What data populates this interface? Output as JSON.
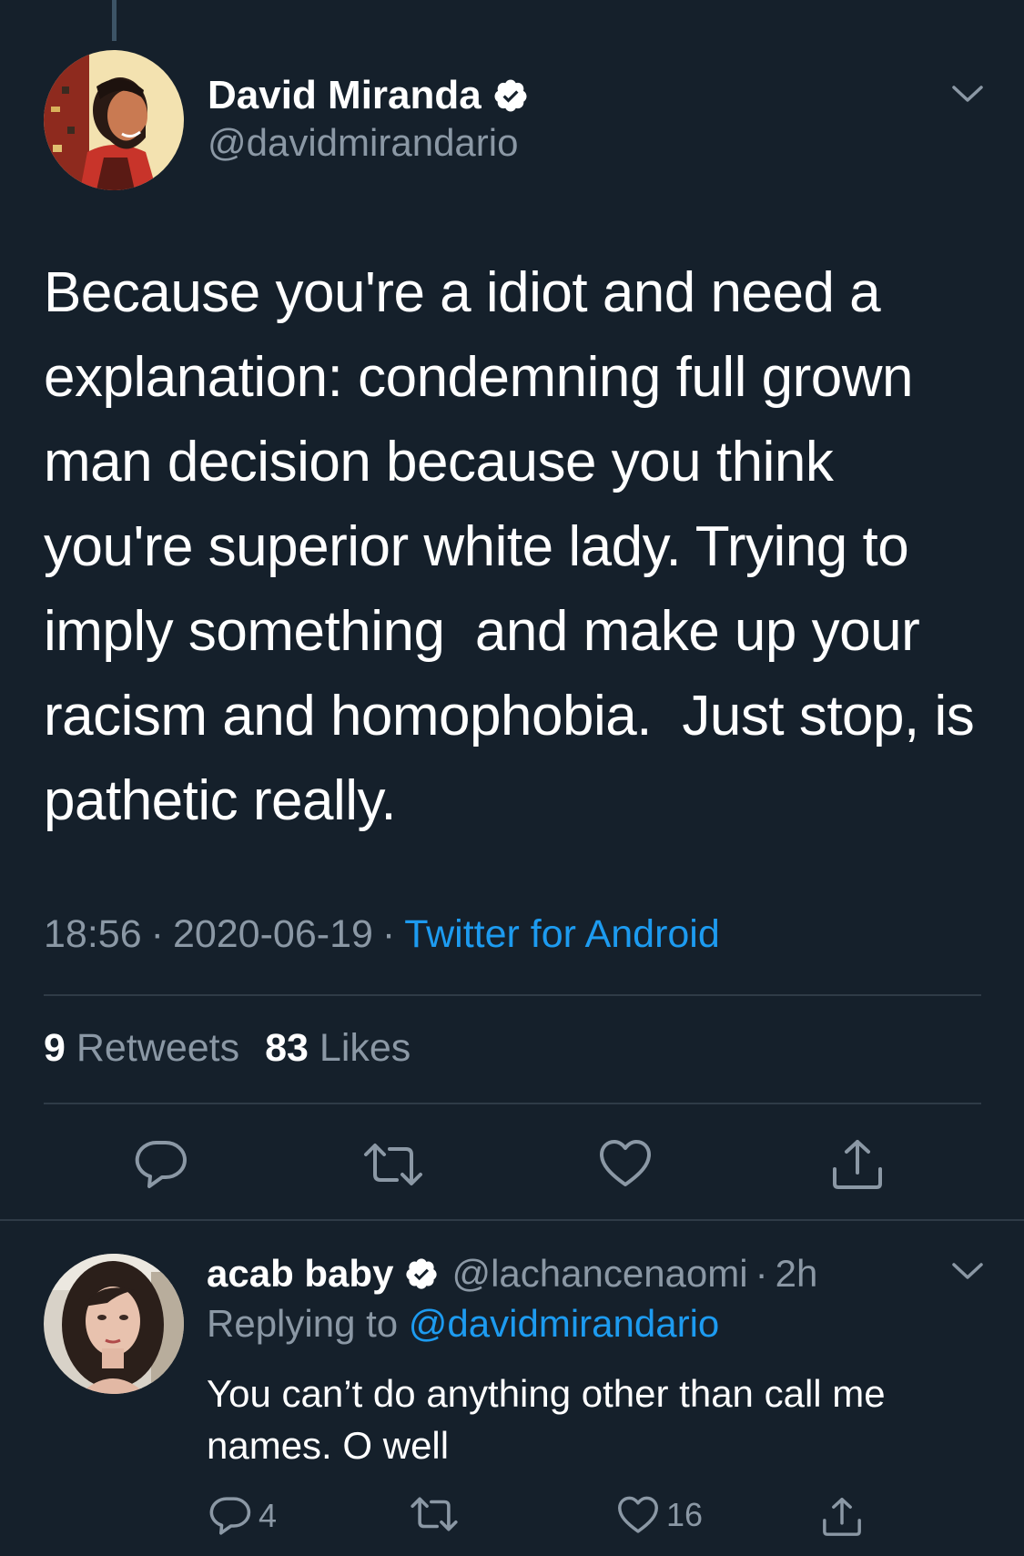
{
  "main_tweet": {
    "author_name": "David Miranda",
    "author_handle": "@davidmirandario",
    "text": "Because you're a idiot and need a explanation: condemning full grown man decision because you think you're superior white lady. Trying to imply something  and make up your racism and homophobia.  Just stop, is pathetic really.",
    "time": "18:56",
    "date": "2020-06-19",
    "separator": "·",
    "source": "Twitter for Android",
    "retweets_count": "9",
    "retweets_label": "Retweets",
    "likes_count": "83",
    "likes_label": "Likes",
    "icons": {
      "verified": "verified-badge-icon",
      "menu": "chevron-down-icon",
      "reply": "reply-icon",
      "retweet": "retweet-icon",
      "like": "heart-icon",
      "share": "share-icon"
    }
  },
  "reply_tweet": {
    "author_name": "acab baby",
    "author_handle": "@lachancenaomi",
    "dot": "·",
    "time": "2h",
    "replying_to_label": "Replying to",
    "replying_to_handle": "@davidmirandario",
    "text": "You can’t do anything other than call me names. O well",
    "reply_count": "4",
    "like_count": "16"
  },
  "colors": {
    "background": "#15202b",
    "text_primary": "#ffffff",
    "text_secondary": "#8b98a5",
    "link": "#1d9bf0",
    "divider": "#2f3b47"
  }
}
